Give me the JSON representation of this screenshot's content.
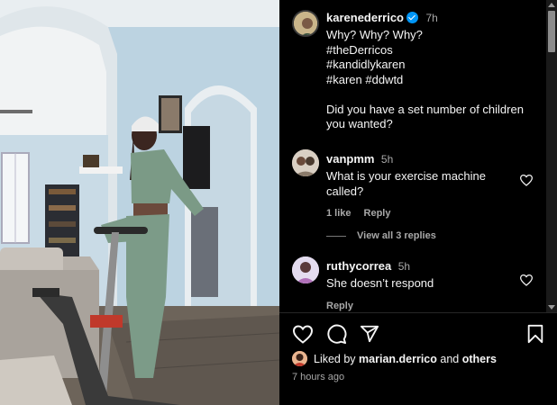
{
  "post": {
    "author": "karenederrico",
    "time": "7h",
    "caption_lines": [
      "Why? Why? Why?",
      "#theDerricos",
      "#kandidlykaren",
      "#karen #ddwtd",
      "",
      "Did you have a set number of children you wanted?"
    ]
  },
  "comments": [
    {
      "username": "vanpmm",
      "time": "5h",
      "text": "What is your exercise machine called?",
      "likes": "1 like",
      "reply_label": "Reply"
    },
    {
      "username": "ruthycorrea",
      "time": "5h",
      "text": "She doesn’t respond",
      "reply_label": "Reply"
    }
  ],
  "view_replies_label": "View all 3 replies",
  "liked_by": {
    "prefix": "Liked by",
    "user": "marian.derrico",
    "and": "and",
    "others": "others"
  },
  "posted_ago": "7 hours ago",
  "icons": {
    "like": "heart-icon",
    "comment": "comment-icon",
    "share": "send-icon",
    "save": "bookmark-icon",
    "verified": "verified-badge-icon"
  },
  "colors": {
    "background": "#000000",
    "text": "#f5f5f5",
    "secondary_text": "#a8a8a8",
    "verified": "#0095f6"
  }
}
